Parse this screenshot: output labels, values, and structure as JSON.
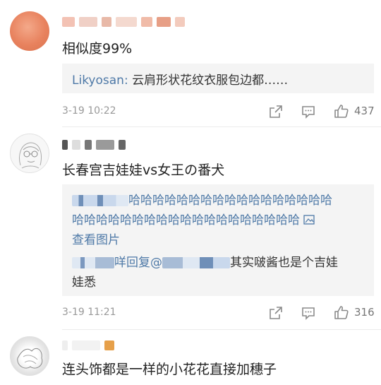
{
  "comments": [
    {
      "text": "相似度99%",
      "quote": {
        "user": "Likyosan:",
        "content": " 云肩形状花纹衣服包边都……"
      },
      "time": "3-19 10:22",
      "likes": "437",
      "icons": [
        "share-icon",
        "comment-icon",
        "thumbs-up-icon"
      ]
    },
    {
      "text": "长春宫吉娃娃vs女王の番犬",
      "quote": {
        "line1_text": "哈哈哈哈哈哈哈哈哈哈哈哈哈哈哈哈哈",
        "line2_text": "哈哈哈哈哈哈哈哈哈哈哈哈哈哈哈哈哈哈哈",
        "view_image": "查看图片",
        "reply_word": "咩回复@",
        "reply_text": "其实啵酱也是个吉娃",
        "reply_text2": "娃悉"
      },
      "time": "3-19 11:21",
      "likes": "316",
      "icons": [
        "share-icon",
        "comment-icon",
        "thumbs-up-icon"
      ]
    },
    {
      "text": "连头饰都是一样的小花花直接加穗子"
    }
  ],
  "colors": {
    "link": "#4e79a7",
    "meta": "#999999",
    "quote_bg": "#f4f4f4"
  }
}
